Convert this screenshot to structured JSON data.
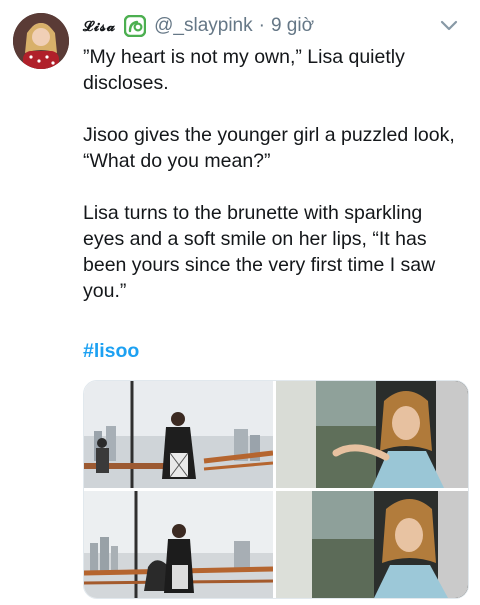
{
  "author": {
    "display_name": "𝓛𝓲𝓼𝓪",
    "badge_icon": "green-sprout-icon",
    "handle": "@_slaypink",
    "separator": "·",
    "time": "9 giờ"
  },
  "menu_icon": "chevron-down-icon",
  "tweet": {
    "paragraphs": [
      "”My heart is not my own,” Lisa quietly discloses.",
      "Jisoo gives the younger girl a puzzled look, “What do you mean?”",
      "Lisa turns to the brunette with sparkling eyes and a soft smile on her lips, “It has been yours since the very first time I saw you.”"
    ],
    "hashtag": "#lisoo"
  },
  "media": {
    "count": 4,
    "photos": [
      {
        "name": "photo-bridge-1"
      },
      {
        "name": "photo-window-1"
      },
      {
        "name": "photo-bridge-2"
      },
      {
        "name": "photo-window-2"
      }
    ]
  },
  "colors": {
    "text": "#14171a",
    "secondary": "#657786",
    "link": "#1da1f2",
    "badge_green": "#4caf50"
  }
}
